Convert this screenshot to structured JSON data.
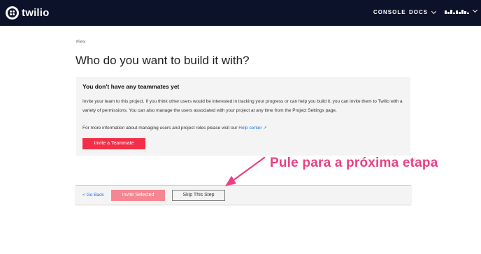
{
  "header": {
    "logo_text": "twilio",
    "nav": {
      "console": "CONSOLE",
      "docs": "DOCS"
    },
    "account_icon": "redacted-account-name"
  },
  "breadcrumb": "Flex",
  "title": "Who do you want to build it with?",
  "panel": {
    "heading": "You don't have any teammates yet",
    "paragraph1": "Invite your team to this project. If you think other users would be interested in tracking your progress or can help you build it, you can invite them to Twilio with a variety of permissions. You can also manage the users associated with your project at any time from the Project Settings page.",
    "paragraph2": "For more information about managing users and project roles please visit our",
    "help_link": "Help center",
    "help_link_icon": "external-link-icon",
    "invite_button": "Invite a Teammate"
  },
  "footer": {
    "go_back": "< Go Back",
    "invite_selected": "Invite Selected",
    "skip": "Skip This Step"
  },
  "annotation": {
    "text": "Pule para a próxima etapa",
    "color": "#ec3f82"
  },
  "colors": {
    "topbar": "#0d122b",
    "brand_red": "#f22f46",
    "disabled_red": "#f68692",
    "link_blue": "#1a73e8"
  }
}
